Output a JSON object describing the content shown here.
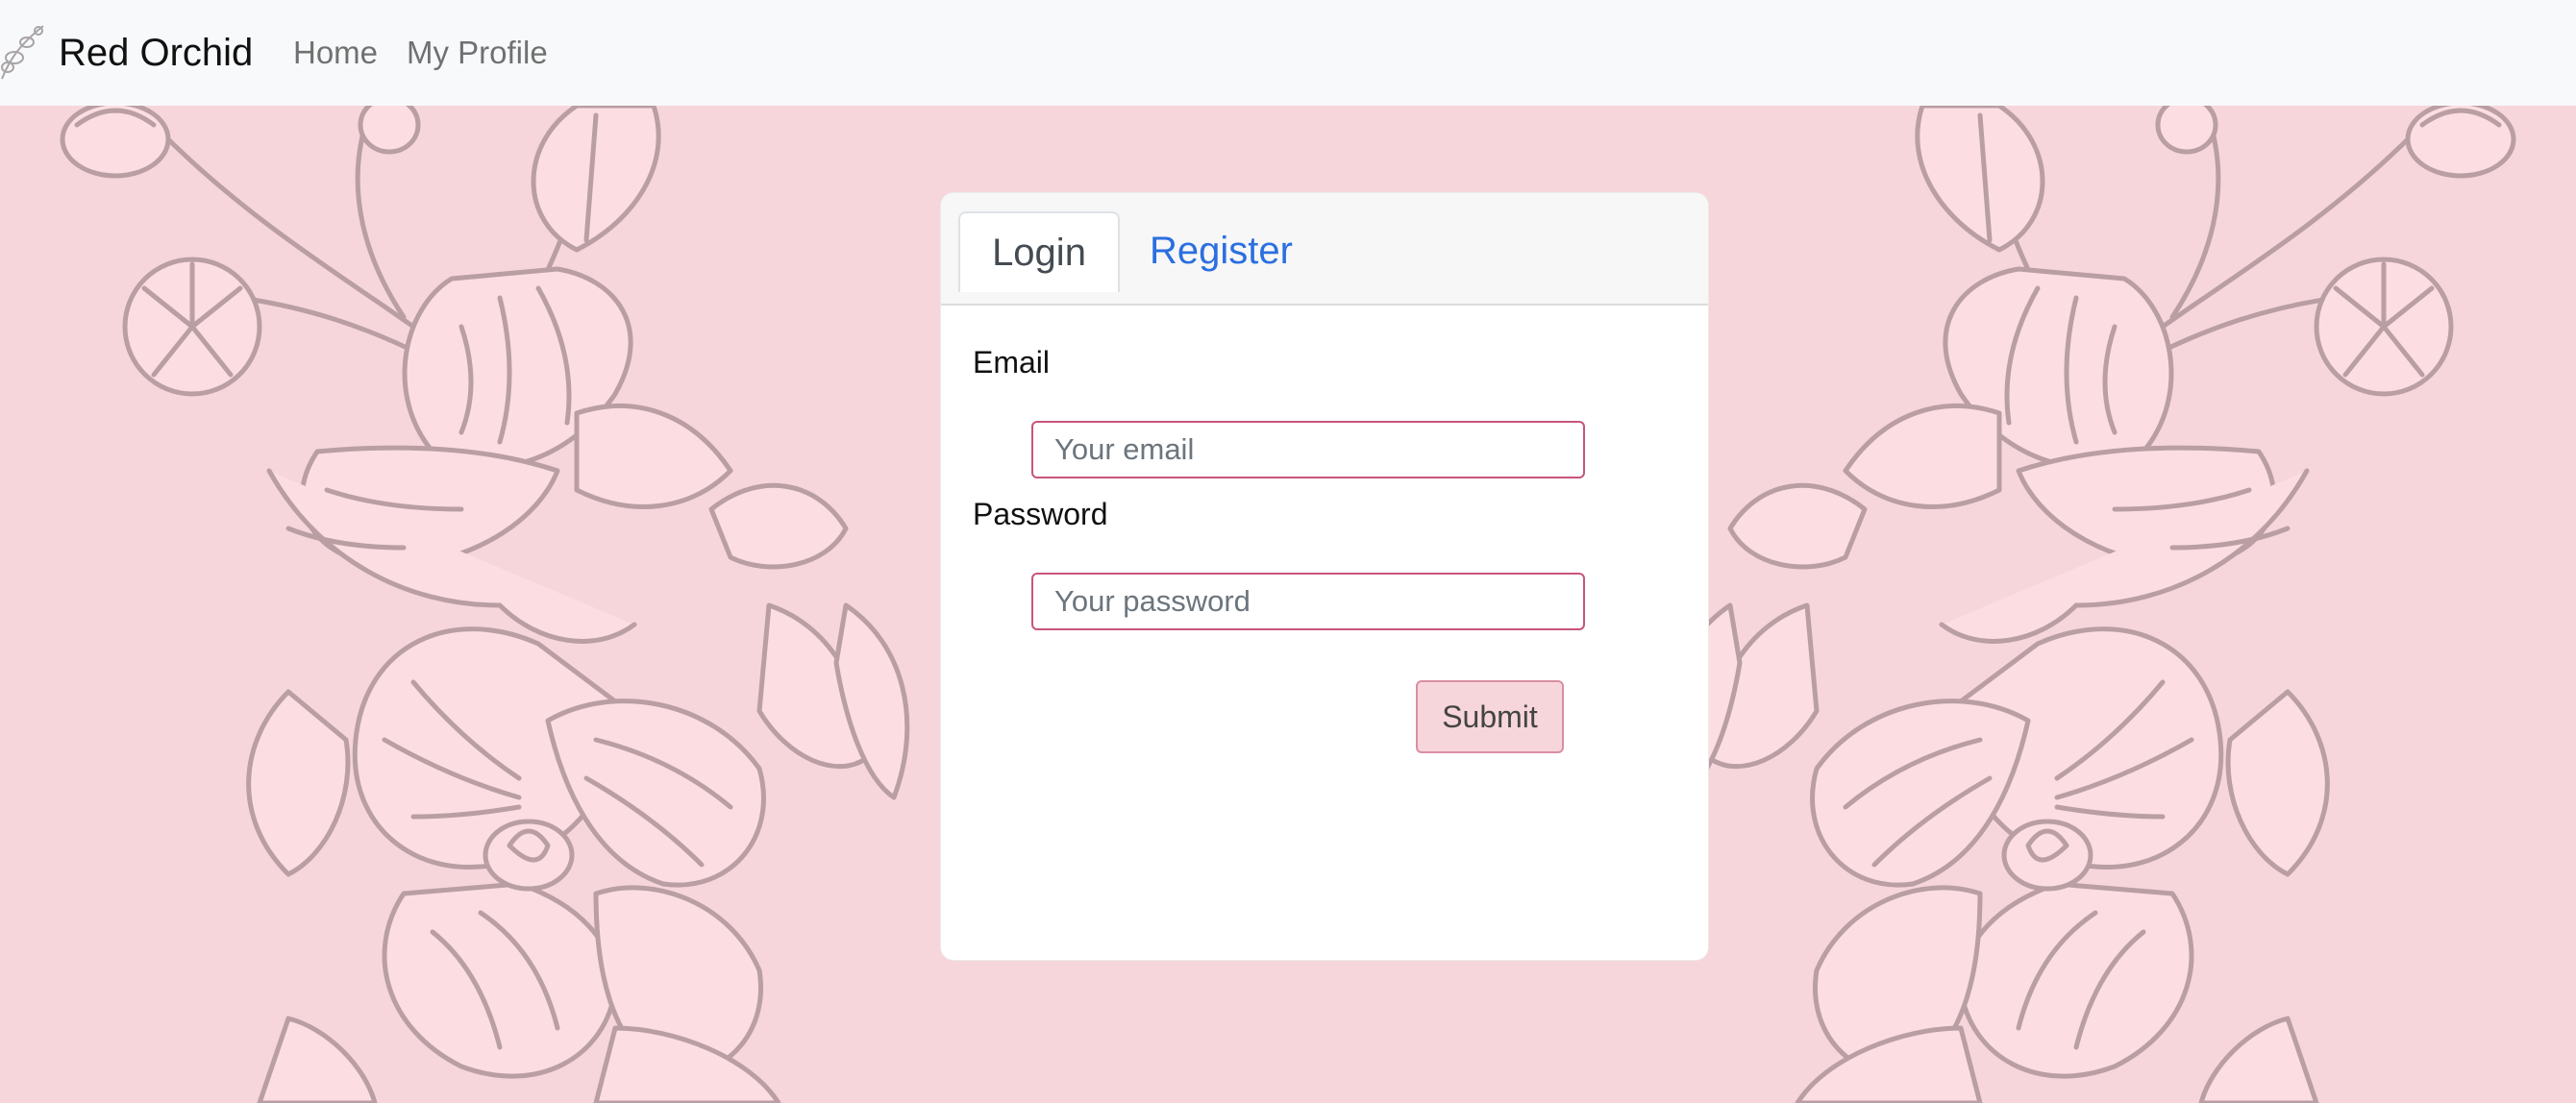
{
  "navbar": {
    "brand_name": "Red Orchid",
    "brand_logo": "orchid-logo",
    "links": [
      {
        "label": "Home"
      },
      {
        "label": "My Profile"
      }
    ]
  },
  "auth_card": {
    "tabs": [
      {
        "label": "Login",
        "active": true
      },
      {
        "label": "Register",
        "active": false
      }
    ],
    "email_label": "Email",
    "email_placeholder": "Your email",
    "password_label": "Password",
    "password_placeholder": "Your password",
    "submit_label": "Submit"
  },
  "colors": {
    "background": "#f7d6db",
    "navbar": "#f8f9fa",
    "tab_link": "#2b6fe0",
    "input_border": "#c7557a",
    "submit_bg": "#f7d6db",
    "floral_line": "#b99ea4"
  }
}
